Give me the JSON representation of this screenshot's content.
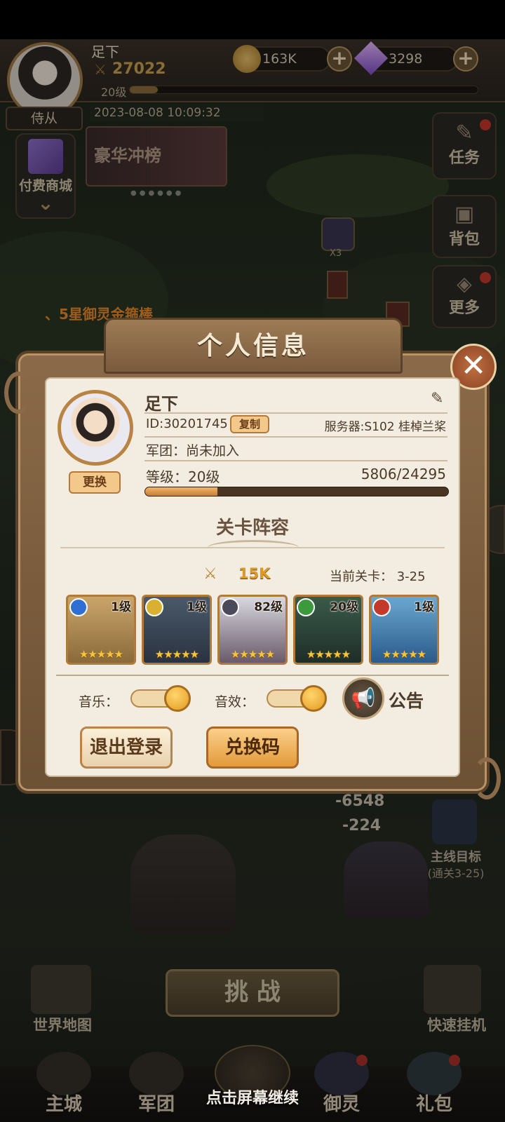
{
  "header": {
    "player_name": "足下",
    "power": "27022",
    "level": "20级",
    "gold": "163K",
    "gems": "3298",
    "attendant_label": "侍从",
    "timestamp": "2023-08-08 10:09:32"
  },
  "left_side": {
    "shop_label": "付费商城",
    "event_banner": "豪华冲榜"
  },
  "right_side": {
    "task": "任务",
    "bag": "背包",
    "more": "更多"
  },
  "map": {
    "marker_count": "X3",
    "announcement": "、5星御灵金箍棒"
  },
  "modal": {
    "title": "个人信息",
    "name": "足下",
    "id": "ID:30201745",
    "copy_label": "复制",
    "server": "服务器:S102 桂棹兰桨",
    "guild": "军团：尚未加入",
    "level_label": "等级：20级",
    "exp": "5806/24295",
    "exp_progress": 0.239,
    "change_label": "更换",
    "lineup_title": "关卡阵容",
    "lineup_power": "15K",
    "current_stage": "当前关卡：  3-25",
    "heroes": [
      {
        "level": "1级",
        "stars": "★★★★★",
        "element_color": "#2f6fd4"
      },
      {
        "level": "1级",
        "stars": "★★★★★",
        "element_color": "#d9b030"
      },
      {
        "level": "82级",
        "stars": "★★★★★",
        "element_color": "#4a4a5a"
      },
      {
        "level": "20级",
        "stars": "★★★★★",
        "element_color": "#3b9a3b"
      },
      {
        "level": "1级",
        "stars": "★★★★★",
        "element_color": "#c43a2a"
      }
    ],
    "music_label": "音乐：",
    "sfx_label": "音效：",
    "notice_label": "公告",
    "logout_label": "退出登录",
    "redeem_label": "兑换码"
  },
  "battle": {
    "damage1": "-6548",
    "damage2": "-224",
    "mainline_goal": "主线目标",
    "mainline_detail": "(通关3-25)"
  },
  "bottom": {
    "challenge": "挑 战",
    "world_map": "世界地图",
    "quick_idle": "快速挂机",
    "nav": [
      "主城",
      "军团",
      "御灵",
      "礼包"
    ],
    "continue_hint": "点击屏幕继续"
  }
}
